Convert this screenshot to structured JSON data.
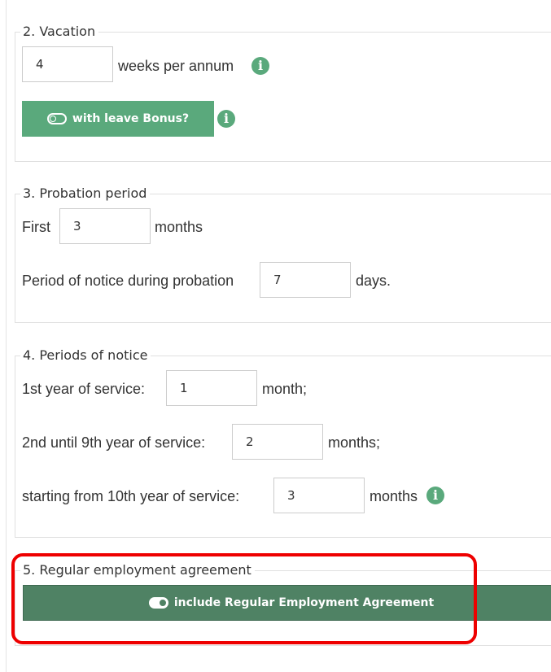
{
  "vacation": {
    "legend": "2. Vacation",
    "weeks_value": "4",
    "weeks_label": "weeks per annum",
    "leave_bonus_button": "with leave Bonus?"
  },
  "probation": {
    "legend": "3. Probation period",
    "first_label": "First",
    "months_value": "3",
    "months_label": "months",
    "notice_label": "Period of notice during probation",
    "notice_value": "7",
    "days_label": "days."
  },
  "notice": {
    "legend": "4. Periods of notice",
    "year1_label": "1st year of service:",
    "year1_value": "1",
    "year1_unit": "month;",
    "year2_label": "2nd until 9th year of service:",
    "year2_value": "2",
    "year2_unit": "months;",
    "year10_label": "starting from 10th year of service:",
    "year10_value": "3",
    "year10_unit": "months"
  },
  "regular": {
    "legend": "5. Regular employment agreement",
    "include_button": "include Regular Employment Agreement"
  },
  "icons": {
    "info": "info-icon",
    "toggle_off": "toggle-off-icon",
    "toggle_on": "toggle-on-icon"
  },
  "colors": {
    "accent_green": "#5aa97c",
    "dark_green": "#4f8264",
    "highlight_red": "#ee0000",
    "border": "#e0e0e0"
  }
}
